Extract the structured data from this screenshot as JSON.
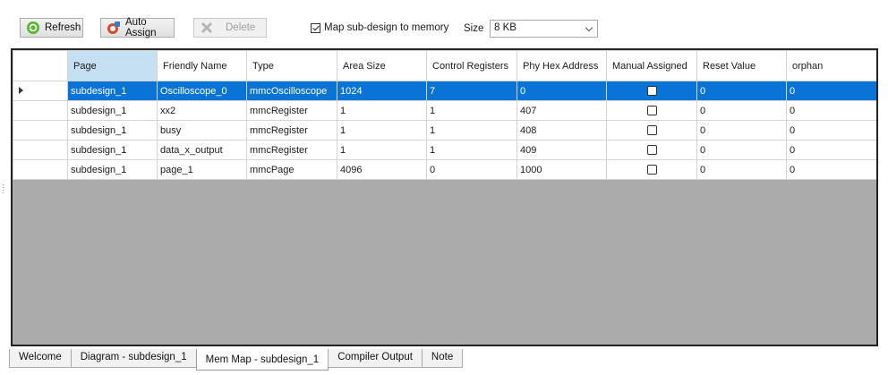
{
  "toolbar": {
    "refresh_label": "Refresh",
    "auto_assign_label": "Auto Assign",
    "delete_label": "Delete",
    "map_checkbox_label": "Map sub-design to memory",
    "map_checked": true,
    "size_label": "Size",
    "size_value": "8 KB"
  },
  "grid": {
    "columns": [
      "Page",
      "Friendly Name",
      "Type",
      "Area Size",
      "Control Registers",
      "Phy Hex Address",
      "Manual Assigned",
      "Reset Value",
      "orphan"
    ],
    "rows": [
      {
        "page": "subdesign_1",
        "friendly": "Oscilloscope_0",
        "type": "mmcOscilloscope",
        "area": "1024",
        "control": "7",
        "phy": "0",
        "manual": false,
        "reset": "0",
        "orphan": "0"
      },
      {
        "page": "subdesign_1",
        "friendly": "xx2",
        "type": "mmcRegister",
        "area": "1",
        "control": "1",
        "phy": "407",
        "manual": false,
        "reset": "0",
        "orphan": "0"
      },
      {
        "page": "subdesign_1",
        "friendly": "busy",
        "type": "mmcRegister",
        "area": "1",
        "control": "1",
        "phy": "408",
        "manual": false,
        "reset": "0",
        "orphan": "0"
      },
      {
        "page": "subdesign_1",
        "friendly": "data_x_output",
        "type": "mmcRegister",
        "area": "1",
        "control": "1",
        "phy": "409",
        "manual": false,
        "reset": "0",
        "orphan": "0"
      },
      {
        "page": "subdesign_1",
        "friendly": "page_1",
        "type": "mmcPage",
        "area": "4096",
        "control": "0",
        "phy": "1000",
        "manual": false,
        "reset": "0",
        "orphan": "0"
      }
    ],
    "selected_row": 0,
    "selection_color": "#0a74d6"
  },
  "tabs": [
    "Welcome",
    "Diagram - subdesign_1",
    "Mem Map - subdesign_1",
    "Compiler Output",
    "Note"
  ],
  "active_tab": 2
}
